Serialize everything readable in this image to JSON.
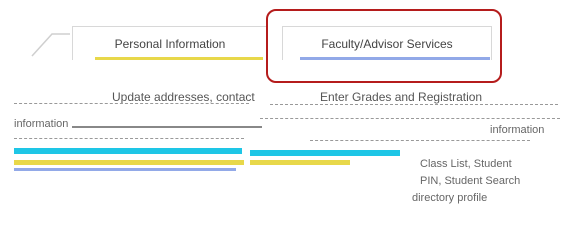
{
  "tabs": [
    {
      "label": "Personal Information"
    },
    {
      "label": "Faculty/Advisor Services"
    }
  ],
  "descriptions": {
    "personal": "Update addresses, contact",
    "faculty": "Enter Grades and Registration"
  },
  "side_lines": {
    "personal_1": "information",
    "personal_2": "information"
  },
  "faculty_lines": {
    "line_3": "Class List, Student",
    "line_4": "PIN, Student Search",
    "line_5": "directory profile"
  },
  "colors": {
    "highlight": "#b51c1c",
    "accent_cyan": "#1ec6e6",
    "accent_yellow": "#e8d84a",
    "accent_blue": "#4a6fd8"
  }
}
